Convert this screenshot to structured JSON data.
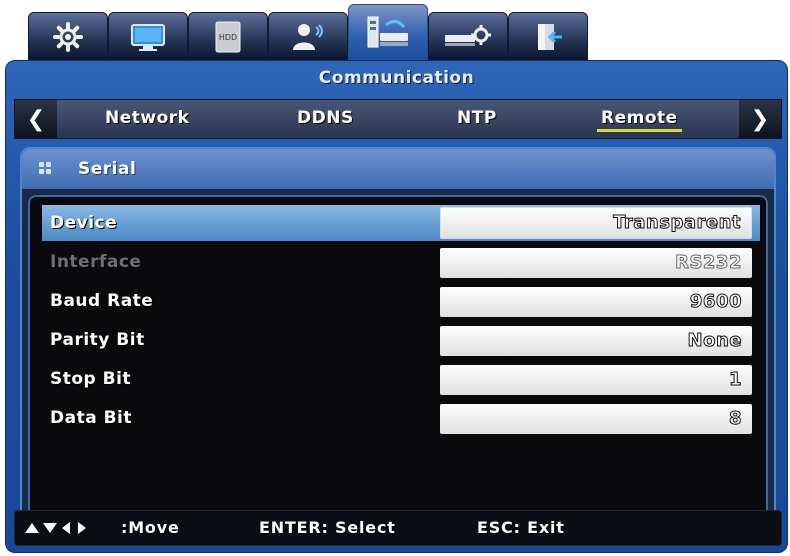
{
  "top_tabs": [
    {
      "icon": "gear-icon"
    },
    {
      "icon": "monitor-icon"
    },
    {
      "icon": "hdd-icon",
      "label": "HDD"
    },
    {
      "icon": "user-icon"
    },
    {
      "icon": "network-icon",
      "active": true
    },
    {
      "icon": "device-settings-icon"
    },
    {
      "icon": "exit-door-icon"
    }
  ],
  "window": {
    "title": "Communication"
  },
  "subtabs": [
    {
      "label": "Network"
    },
    {
      "label": "DDNS"
    },
    {
      "label": "NTP"
    },
    {
      "label": "Remote",
      "active": true
    }
  ],
  "panel": {
    "title": "Serial",
    "rows": [
      {
        "label": "Device",
        "value": "Transparent",
        "selected": true
      },
      {
        "label": "Interface",
        "value": "RS232",
        "disabled": true
      },
      {
        "label": "Baud Rate",
        "value": "9600"
      },
      {
        "label": "Parity Bit",
        "value": "None"
      },
      {
        "label": "Stop Bit",
        "value": "1"
      },
      {
        "label": "Data Bit",
        "value": "8"
      }
    ]
  },
  "status": {
    "move": ":Move",
    "enter": "ENTER: Select",
    "esc": "ESC: Exit"
  },
  "colors": {
    "accent_blue": "#1d4f9f",
    "selected_row": "#6ea4d6",
    "underline_yellow": "#e2d83a"
  }
}
